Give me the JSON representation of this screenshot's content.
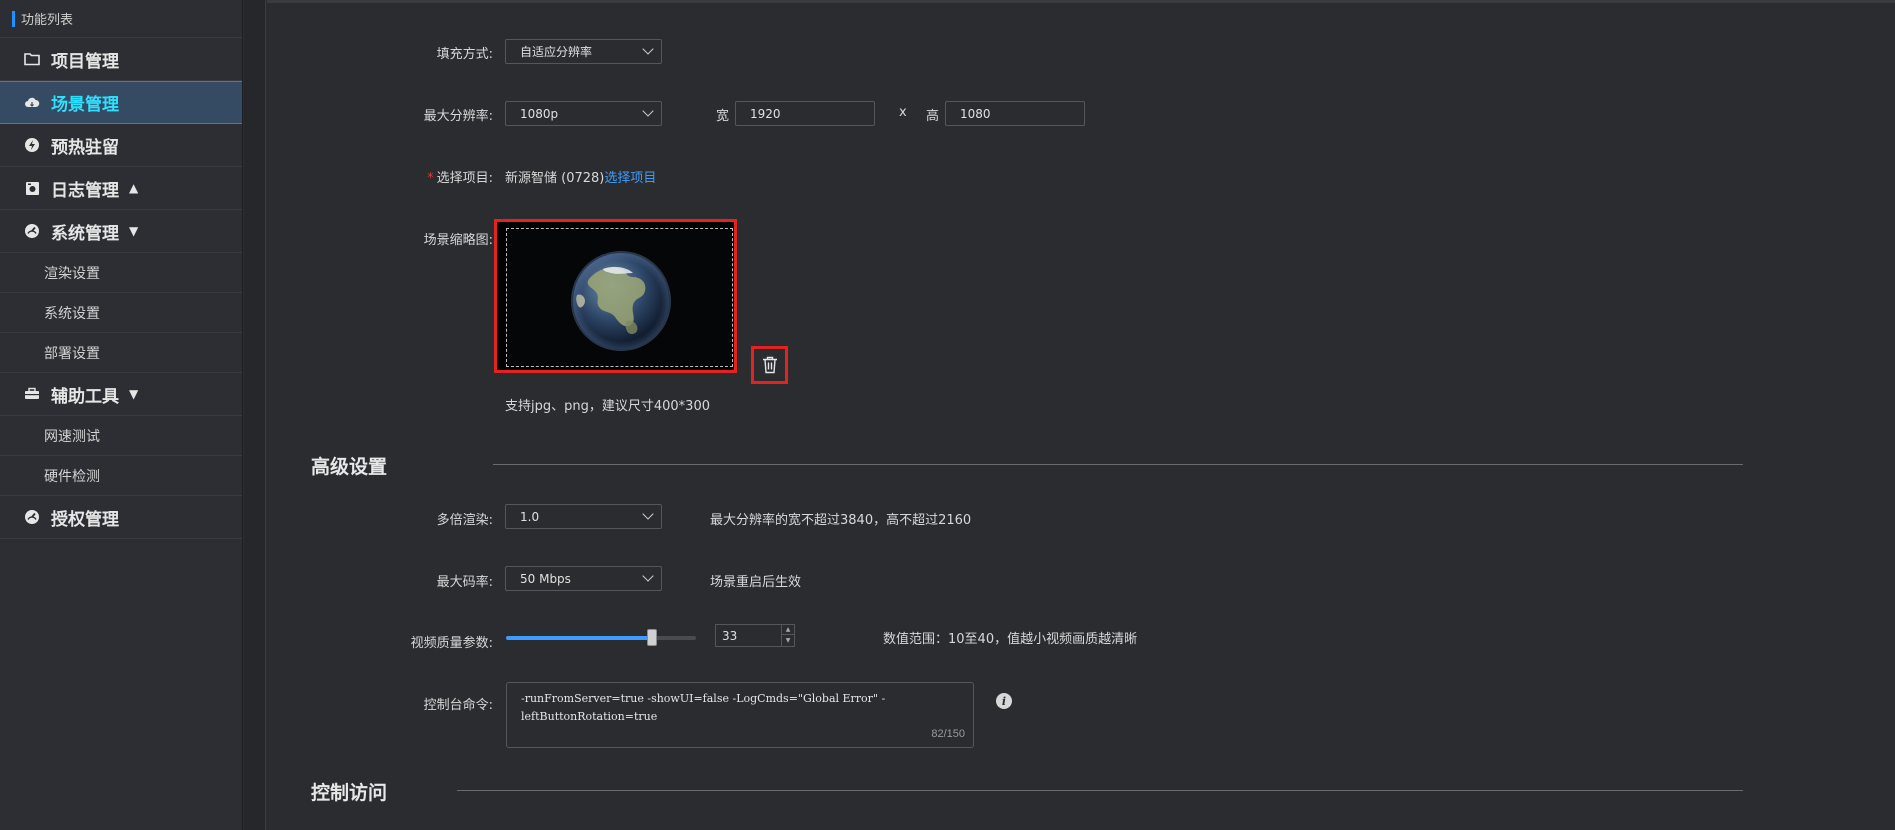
{
  "sidebar": {
    "header": "功能列表",
    "items": [
      {
        "label": "项目管理",
        "icon": "folder-icon"
      },
      {
        "label": "场景管理",
        "icon": "cloud-icon",
        "active": true
      },
      {
        "label": "预热驻留",
        "icon": "lightning-icon"
      },
      {
        "label": "日志管理",
        "icon": "log-icon",
        "arrow": "▲"
      },
      {
        "label": "系统管理",
        "icon": "dashboard-icon",
        "arrow": "▼"
      },
      {
        "label": "辅助工具",
        "icon": "toolbox-icon",
        "arrow": "▼"
      },
      {
        "label": "授权管理",
        "icon": "dashboard-icon"
      }
    ],
    "system_subitems": [
      "渲染设置",
      "系统设置",
      "部署设置"
    ],
    "tools_subitems": [
      "网速测试",
      "硬件检测"
    ]
  },
  "form": {
    "fill_mode": {
      "label": "填充方式:",
      "value": "自适应分辨率"
    },
    "max_resolution": {
      "label": "最大分辨率:",
      "value": "1080p",
      "width_label": "宽",
      "width": "1920",
      "times": "x",
      "height_label": "高",
      "height": "1080"
    },
    "project": {
      "required_mark": "*",
      "label": "选择项目:",
      "value": "新源智储 (0728)",
      "link": "选择项目"
    },
    "thumbnail": {
      "label": "场景缩略图:",
      "hint": "支持jpg、png，建议尺寸400*300"
    }
  },
  "advanced": {
    "title": "高级设置",
    "multi_render": {
      "label": "多倍渲染:",
      "value": "1.0",
      "note": "最大分辨率的宽不超过3840，高不超过2160"
    },
    "max_bitrate": {
      "label": "最大码率:",
      "value": "50 Mbps",
      "note": "场景重启后生效"
    },
    "video_quality": {
      "label": "视频质量参数:",
      "value": "33",
      "min": 10,
      "max": 40,
      "slider_fraction": 0.77,
      "note": "数值范围：10至40，值越小视频画质越清晰"
    },
    "console_command": {
      "label": "控制台命令:",
      "value": "-runFromServer=true -showUI=false -LogCmds=\"Global Error\" -leftButtonRotation=true",
      "count": "82/150"
    }
  },
  "access": {
    "title": "控制访问"
  },
  "colors": {
    "accent": "#3e9cff",
    "active_text": "#2ee0ff",
    "highlight": "#e3231f"
  }
}
